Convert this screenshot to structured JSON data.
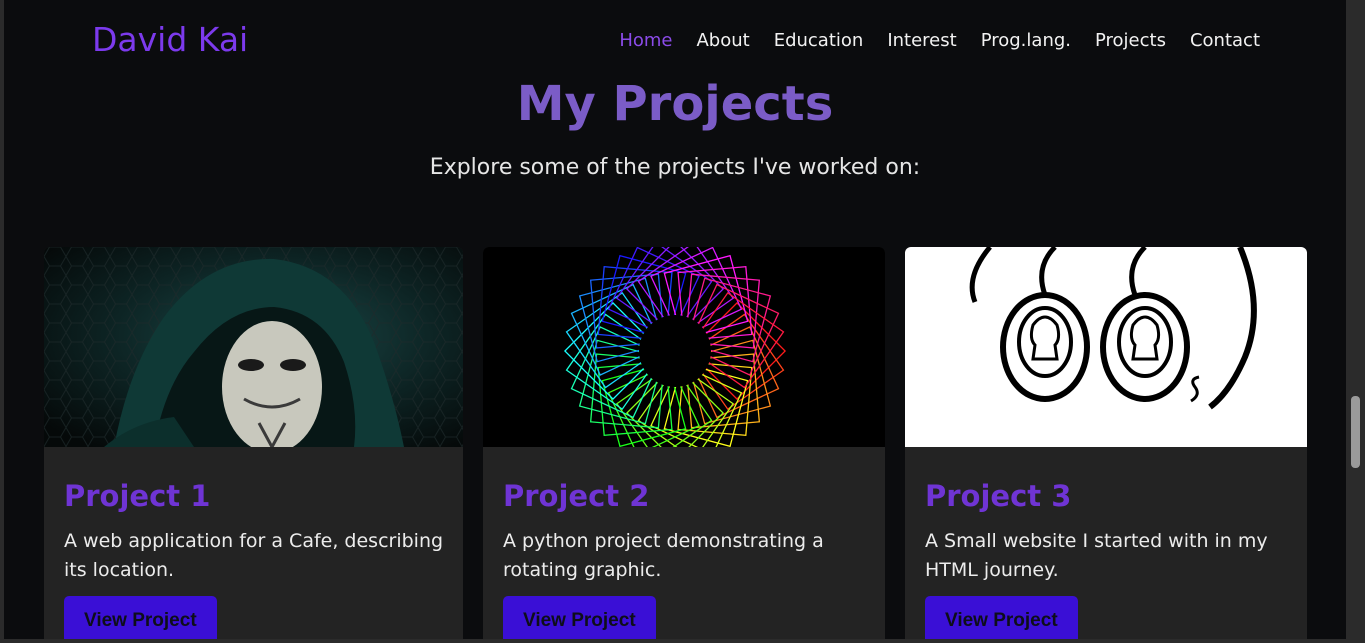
{
  "brand": "David Kai",
  "nav": {
    "items": [
      "Home",
      "About",
      "Education",
      "Interest",
      "Prog.lang.",
      "Projects",
      "Contact"
    ],
    "active": "Home"
  },
  "hero": {
    "title": "My Projects",
    "subtitle": "Explore some of the projects I've worked on:"
  },
  "projects": [
    {
      "title": "Project 1",
      "description": "A web application for a Cafe, describing its location.",
      "button": "View Project"
    },
    {
      "title": "Project 2",
      "description": "A python project demonstrating a rotating graphic.",
      "button": "View Project"
    },
    {
      "title": "Project 3",
      "description": "A Small website I started with in my HTML journey.",
      "button": "View Project"
    }
  ],
  "colors": {
    "brand": "#7c3aed",
    "active_nav": "#8b4be8",
    "heading": "#7b5cc7",
    "card_title": "#6f34d4",
    "button": "#3a0fd6",
    "background": "#0b0c0e",
    "card_bg": "#232323"
  }
}
